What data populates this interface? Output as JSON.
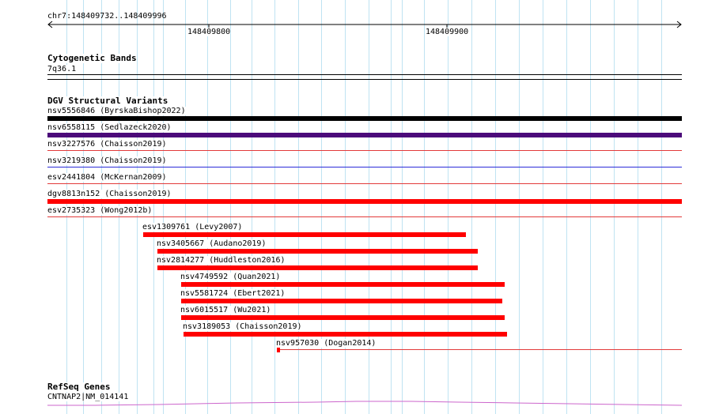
{
  "ruler": {
    "region": "chr7:148409732..148409996",
    "ticks": [
      {
        "label": "148409800"
      },
      {
        "label": "148409900"
      }
    ]
  },
  "tracks": {
    "cytobands": {
      "title": "Cytogenetic Bands",
      "band": "7q36.1"
    },
    "dgv": {
      "title": "DGV Structural Variants",
      "features": [
        {
          "id": "nsv5556846",
          "study": "ByrskaBishop2022",
          "label": "nsv5556846 (ByrskaBishop2022)",
          "color": "#000000",
          "style": "thick",
          "span": "full"
        },
        {
          "id": "nsv6558115",
          "study": "Sedlazeck2020",
          "label": "nsv6558115 (Sedlazeck2020)",
          "color": "#4b0a7a",
          "style": "thick",
          "span": "full"
        },
        {
          "id": "nsv3227576",
          "study": "Chaisson2019",
          "label": "nsv3227576 (Chaisson2019)",
          "color": "#e23a3a",
          "style": "thin",
          "span": "full"
        },
        {
          "id": "nsv3219380",
          "study": "Chaisson2019",
          "label": "nsv3219380 (Chaisson2019)",
          "color": "#2b2bd8",
          "style": "thin",
          "span": "full"
        },
        {
          "id": "esv2441804",
          "study": "McKernan2009",
          "label": "esv2441804 (McKernan2009)",
          "color": "#e23a3a",
          "style": "thin",
          "span": "full"
        },
        {
          "id": "dgv8813n152",
          "study": "Chaisson2019",
          "label": "dgv8813n152 (Chaisson2019)",
          "color": "#ff0000",
          "style": "thick",
          "span": "full"
        },
        {
          "id": "esv2735323",
          "study": "Wong2012b",
          "label": "esv2735323 (Wong2012b)",
          "color": "#e23a3a",
          "style": "thin",
          "span": "full"
        },
        {
          "id": "esv1309761",
          "study": "Levy2007",
          "label": "esv1309761 (Levy2007)",
          "color": "#ff0000",
          "style": "thick",
          "span": "partial"
        },
        {
          "id": "nsv3405667",
          "study": "Audano2019",
          "label": "nsv3405667 (Audano2019)",
          "color": "#ff0000",
          "style": "thick",
          "span": "partial"
        },
        {
          "id": "nsv2814277",
          "study": "Huddleston2016",
          "label": "nsv2814277 (Huddleston2016)",
          "color": "#ff0000",
          "style": "thick",
          "span": "partial"
        },
        {
          "id": "nsv4749592",
          "study": "Quan2021",
          "label": "nsv4749592 (Quan2021)",
          "color": "#ff0000",
          "style": "thick",
          "span": "partial"
        },
        {
          "id": "nsv5581724",
          "study": "Ebert2021",
          "label": "nsv5581724 (Ebert2021)",
          "color": "#ff0000",
          "style": "thick",
          "span": "partial"
        },
        {
          "id": "nsv6015517",
          "study": "Wu2021",
          "label": "nsv6015517 (Wu2021)",
          "color": "#ff0000",
          "style": "thick",
          "span": "partial"
        },
        {
          "id": "nsv3189053",
          "study": "Chaisson2019",
          "label": "nsv3189053 (Chaisson2019)",
          "color": "#ff0000",
          "style": "thick",
          "span": "partial"
        },
        {
          "id": "nsv957030",
          "study": "Dogan2014",
          "label": "nsv957030 (Dogan2014)",
          "color": "#e23a3a",
          "style": "thin-with-block",
          "span": "partial"
        }
      ]
    },
    "refseq": {
      "title": "RefSeq Genes",
      "gene": "CNTNAP2|NM_014141",
      "color": "#cc66cc"
    }
  },
  "colors": {
    "grid": "#bfe3f2",
    "background": "#ffffff"
  }
}
